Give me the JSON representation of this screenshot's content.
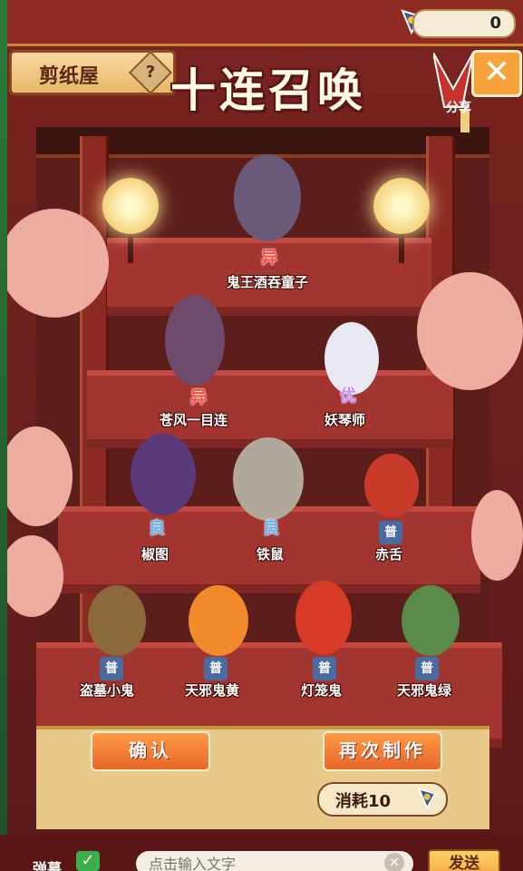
{
  "header": {
    "banner": "剪纸屋",
    "help": "?",
    "title": "十连召唤",
    "currency_amount": "0",
    "close": "✕",
    "share": "分享"
  },
  "characters": [
    {
      "name": "鬼王酒吞童子",
      "rarity": "异",
      "rarity_class": "rarity-yi",
      "color": "#6a5a7a"
    },
    {
      "name": "苍风一目连",
      "rarity": "异",
      "rarity_class": "rarity-yi",
      "color": "#6e4a6c"
    },
    {
      "name": "妖琴师",
      "rarity": "优",
      "rarity_class": "rarity-you",
      "color": "#e8e8f2"
    },
    {
      "name": "椒图",
      "rarity": "良",
      "rarity_class": "rarity-liang",
      "color": "#5a3a7a"
    },
    {
      "name": "铁鼠",
      "rarity": "良",
      "rarity_class": "rarity-liang",
      "color": "#b0a89a"
    },
    {
      "name": "赤舌",
      "rarity": "普",
      "rarity_class": "rarity-pu",
      "color": "#c83a2a"
    },
    {
      "name": "盗墓小鬼",
      "rarity": "普",
      "rarity_class": "rarity-pu",
      "color": "#8a6a3a"
    },
    {
      "name": "天邪鬼黄",
      "rarity": "普",
      "rarity_class": "rarity-pu",
      "color": "#f08a2a"
    },
    {
      "name": "灯笼鬼",
      "rarity": "普",
      "rarity_class": "rarity-pu",
      "color": "#d83a2a"
    },
    {
      "name": "天邪鬼绿",
      "rarity": "普",
      "rarity_class": "rarity-pu",
      "color": "#5a8a4a"
    }
  ],
  "actions": {
    "confirm": "确认",
    "again": "再次制作",
    "cost": "消耗10"
  },
  "bottom": {
    "danmu_label": "弹幕",
    "input_placeholder": "点击输入文字",
    "send": "发送"
  }
}
